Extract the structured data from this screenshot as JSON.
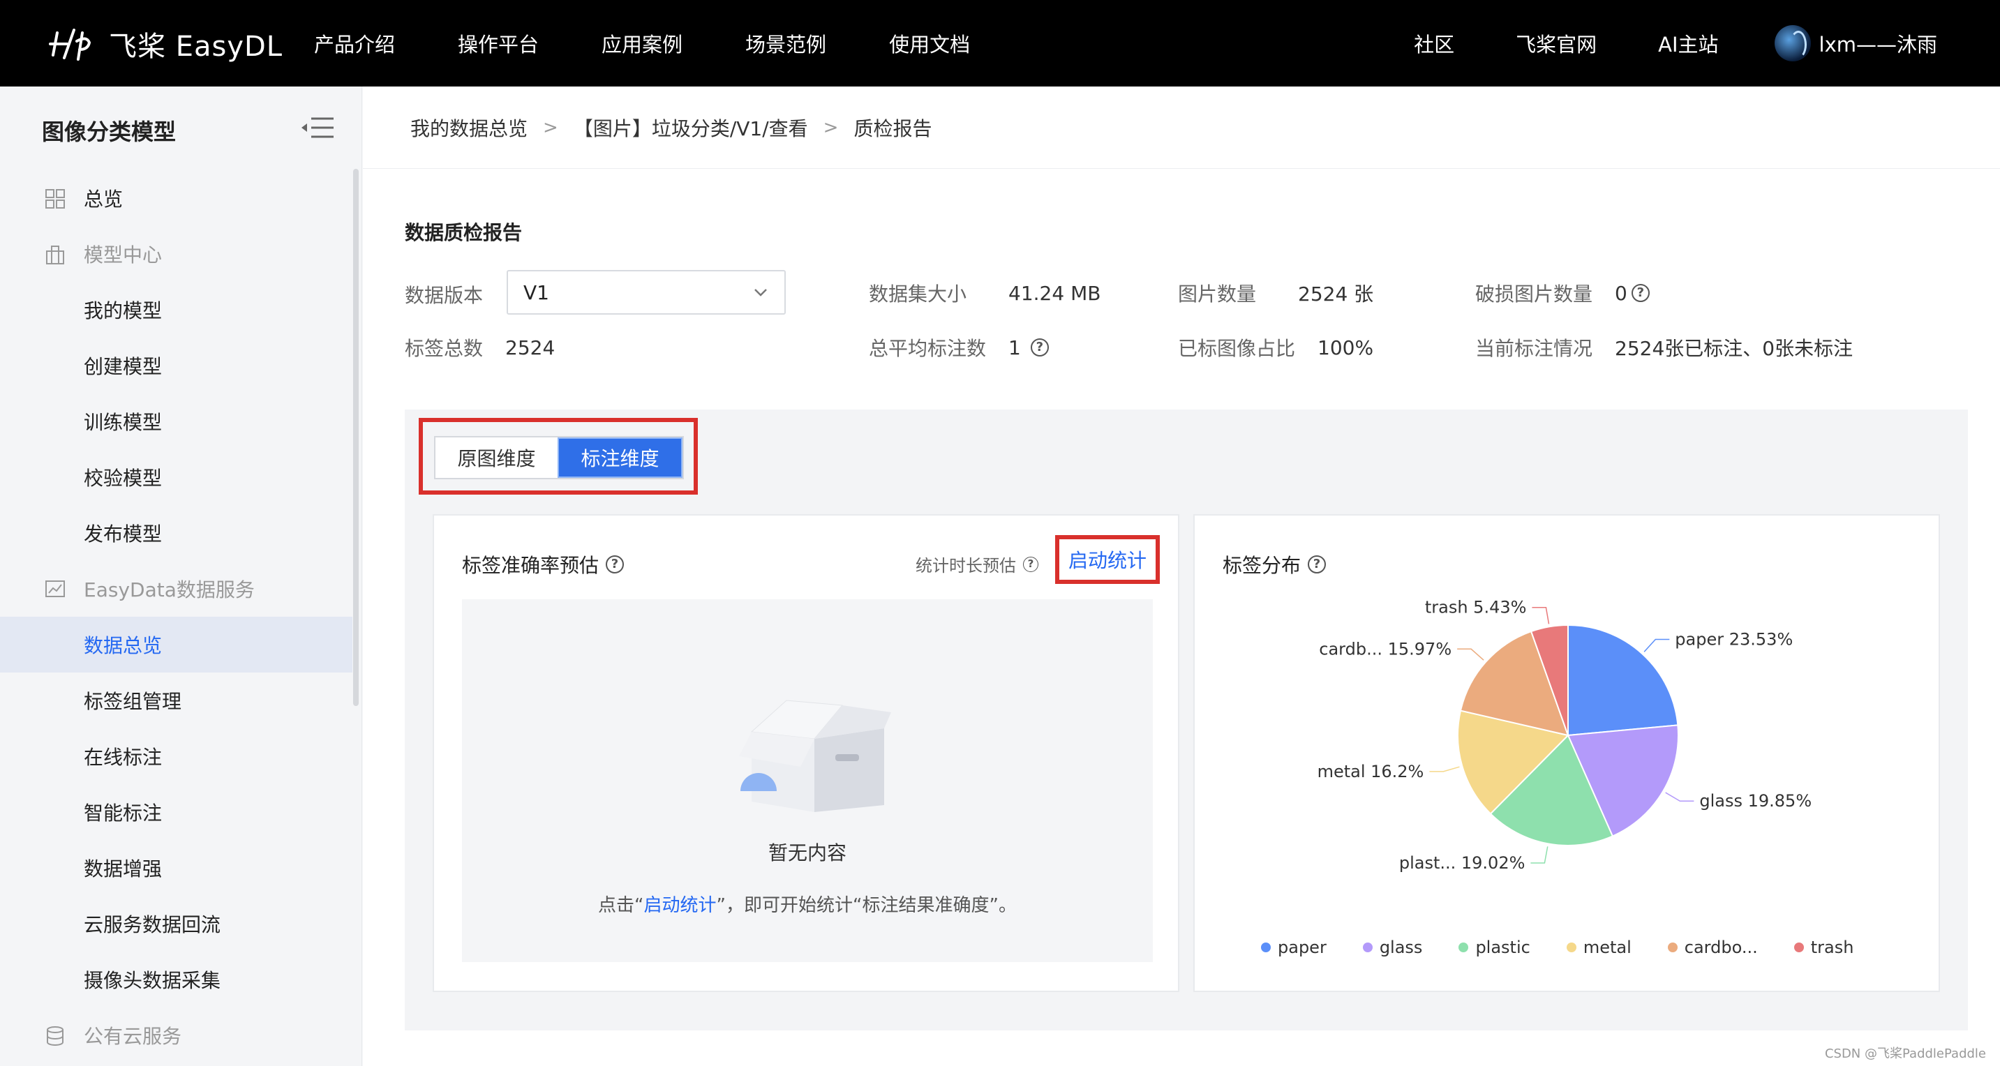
{
  "topbar": {
    "brand": "飞桨 EasyDL",
    "nav": [
      "产品介绍",
      "操作平台",
      "应用案例",
      "场景范例",
      "使用文档"
    ],
    "nav_right": [
      "社区",
      "飞桨官网",
      "AI主站"
    ],
    "user_name": "lxm——沐雨"
  },
  "sidebar": {
    "title": "图像分类模型",
    "items": [
      {
        "label": "总览",
        "kind": "top",
        "icon": "grid-icon"
      },
      {
        "label": "模型中心",
        "kind": "group",
        "icon": "building-icon"
      },
      {
        "label": "我的模型",
        "kind": "item"
      },
      {
        "label": "创建模型",
        "kind": "item"
      },
      {
        "label": "训练模型",
        "kind": "item"
      },
      {
        "label": "校验模型",
        "kind": "item"
      },
      {
        "label": "发布模型",
        "kind": "item"
      },
      {
        "label": "EasyData数据服务",
        "kind": "group",
        "icon": "chart-icon"
      },
      {
        "label": "数据总览",
        "kind": "item",
        "active": true
      },
      {
        "label": "标签组管理",
        "kind": "item"
      },
      {
        "label": "在线标注",
        "kind": "item"
      },
      {
        "label": "智能标注",
        "kind": "item"
      },
      {
        "label": "数据增强",
        "kind": "item"
      },
      {
        "label": "云服务数据回流",
        "kind": "item"
      },
      {
        "label": "摄像头数据采集",
        "kind": "item"
      },
      {
        "label": "公有云服务",
        "kind": "group",
        "icon": "database-icon"
      }
    ]
  },
  "breadcrumb": [
    "我的数据总览",
    "【图片】垃圾分类/V1/查看",
    "质检报告"
  ],
  "report": {
    "title": "数据质检报告",
    "version_label": "数据版本",
    "version_value": "V1",
    "dataset_size_label": "数据集大小",
    "dataset_size_value": "41.24 MB",
    "image_count_label": "图片数量",
    "image_count_value": "2524 张",
    "broken_label": "破损图片数量",
    "broken_value": "0",
    "tag_total_label": "标签总数",
    "tag_total_value": "2524",
    "avg_label": "总平均标注数",
    "avg_value": "1",
    "labeled_ratio_label": "已标图像占比",
    "labeled_ratio_value": "100%",
    "status_label": "当前标注情况",
    "status_value": "2524张已标注、0张未标注"
  },
  "toggle": {
    "original": "原图维度",
    "annotation": "标注维度",
    "active": "annotation"
  },
  "accuracy_card": {
    "title": "标签准确率预估",
    "estimate_label": "统计时长预估",
    "start_button": "启动统计",
    "empty_title": "暂无内容",
    "hint_prefix": "点击“",
    "hint_link": "启动统计",
    "hint_suffix": "”，即可开始统计“标注结果准确度”。"
  },
  "distribution_card": {
    "title": "标签分布"
  },
  "chart_data": {
    "type": "pie",
    "title": "标签分布",
    "slices": [
      {
        "name": "paper",
        "label": "paper",
        "value": 23.53,
        "color": "#5b8ff9"
      },
      {
        "name": "glass",
        "label": "glass",
        "value": 19.85,
        "color": "#b39afa"
      },
      {
        "name": "plastic",
        "label": "plast...",
        "value": 19.02,
        "color": "#8ee0ad"
      },
      {
        "name": "metal",
        "label": "metal",
        "value": 16.2,
        "color": "#f5d88a"
      },
      {
        "name": "cardbo...",
        "label": "cardb...",
        "value": 15.97,
        "color": "#ebab7e"
      },
      {
        "name": "trash",
        "label": "trash",
        "value": 5.43,
        "color": "#e8797a"
      }
    ],
    "legend_position": "bottom"
  },
  "watermark": "CSDN @飞桨PaddlePaddle"
}
